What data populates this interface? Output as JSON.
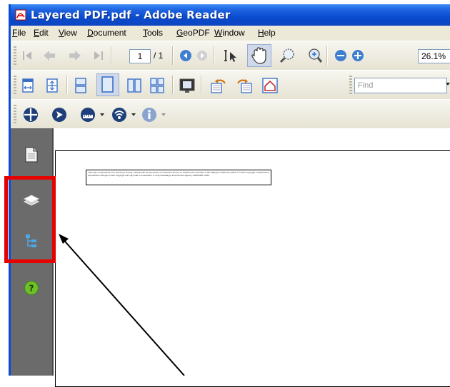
{
  "window": {
    "title": "Layered PDF.pdf - Adobe Reader"
  },
  "menu": [
    "File",
    "Edit",
    "View",
    "Document",
    "Tools",
    "GeoPDF",
    "Window",
    "Help"
  ],
  "menu_access_keys": [
    "F",
    "E",
    "V",
    "D",
    "T",
    "G",
    "W",
    "H"
  ],
  "navigation": {
    "current_page": "1",
    "page_total": "/ 1",
    "zoom": "26.1%"
  },
  "find": {
    "placeholder": "Find"
  },
  "sidebar": {
    "icons": [
      "pages-icon",
      "layers-icon",
      "bookmarks-tree-icon",
      "help-icon"
    ],
    "highlight_color": "#e60000"
  },
  "document": {
    "notice": "This map is reproduced from Ordnance Survey material with the permission of Ordnance Survey on behalf of the controller of Her Majesty's Stationery Office © Crown Copyright. Unauthorised reproduction infringes Crown copyright and may lead to prosecution or civil proceedings. Environment Agency 100026380, 2009."
  },
  "colors": {
    "title_bar": "#0a4bd0",
    "sidebar": "#6b6b6b",
    "toolbar": "#ece9d8"
  }
}
